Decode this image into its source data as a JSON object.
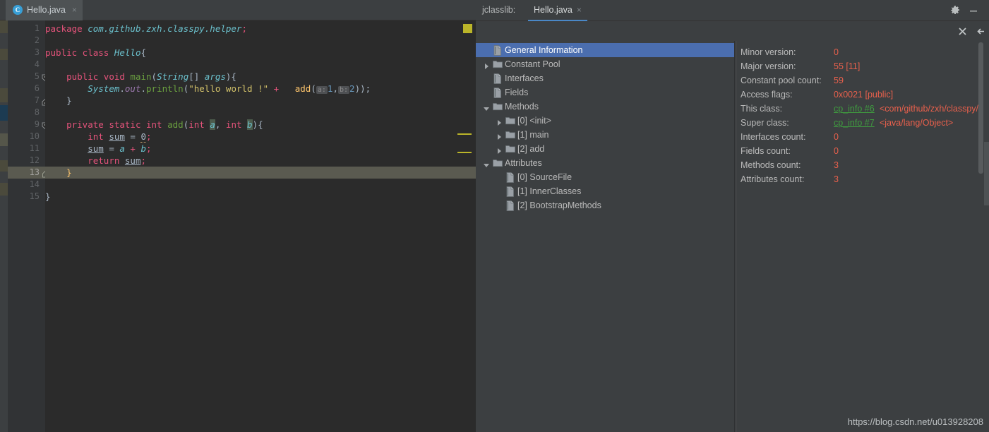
{
  "editor": {
    "tab": {
      "label": "Hello.java",
      "icon": "java-class-icon",
      "badge": "C",
      "close": "×"
    },
    "line_numbers": [
      "1",
      "2",
      "3",
      "4",
      "5",
      "6",
      "7",
      "8",
      "9",
      "10",
      "11",
      "12",
      "13",
      "14",
      "15"
    ],
    "current_line": 13,
    "code_lines": [
      {
        "n": 1,
        "tokens": [
          {
            "t": "package ",
            "c": "pink"
          },
          {
            "t": "com.github.zxh.classpy.helper",
            "c": "cy"
          },
          {
            "t": ";",
            "c": "pink"
          }
        ]
      },
      {
        "n": 2,
        "tokens": []
      },
      {
        "n": 3,
        "tokens": [
          {
            "t": "public class ",
            "c": "pink"
          },
          {
            "t": "Hello",
            "c": "cy"
          },
          {
            "t": "{",
            "c": "brc"
          }
        ]
      },
      {
        "n": 4,
        "tokens": []
      },
      {
        "n": 5,
        "tokens": [
          {
            "t": "    ",
            "c": "pl"
          },
          {
            "t": "public void ",
            "c": "pink"
          },
          {
            "t": "main",
            "c": "grn"
          },
          {
            "t": "(",
            "c": "brc"
          },
          {
            "t": "String",
            "c": "cy"
          },
          {
            "t": "[] ",
            "c": "brc"
          },
          {
            "t": "args",
            "c": "cy"
          },
          {
            "t": "){",
            "c": "brc"
          }
        ]
      },
      {
        "n": 6,
        "tokens": [
          {
            "t": "        ",
            "c": "pl"
          },
          {
            "t": "System",
            "c": "cy"
          },
          {
            "t": ".",
            "c": "brc"
          },
          {
            "t": "out",
            "c": "pur"
          },
          {
            "t": ".",
            "c": "brc"
          },
          {
            "t": "println",
            "c": "grn"
          },
          {
            "t": "(",
            "c": "brc"
          },
          {
            "t": "\"hello world !\"",
            "c": "str"
          },
          {
            "t": " + ",
            "c": "pink"
          },
          {
            "t": "  add",
            "c": "mth"
          },
          {
            "t": "(",
            "c": "brc"
          },
          {
            "t": "a:",
            "c": "hint"
          },
          {
            "t": "1",
            "c": "num"
          },
          {
            "t": ",",
            "c": "brc"
          },
          {
            "t": "b:",
            "c": "hint"
          },
          {
            "t": "2",
            "c": "num"
          },
          {
            "t": "));",
            "c": "brc"
          }
        ]
      },
      {
        "n": 7,
        "tokens": [
          {
            "t": "    }",
            "c": "brc"
          }
        ]
      },
      {
        "n": 8,
        "tokens": []
      },
      {
        "n": 9,
        "tokens": [
          {
            "t": "    ",
            "c": "pl"
          },
          {
            "t": "private static int ",
            "c": "pink"
          },
          {
            "t": "add",
            "c": "grn"
          },
          {
            "t": "(",
            "c": "brc"
          },
          {
            "t": "int ",
            "c": "pink"
          },
          {
            "t": "a",
            "c": "pbg-cy"
          },
          {
            "t": ", ",
            "c": "brc"
          },
          {
            "t": "int ",
            "c": "pink"
          },
          {
            "t": "b",
            "c": "pbg-cy"
          },
          {
            "t": "){",
            "c": "brc"
          }
        ]
      },
      {
        "n": 10,
        "tokens": [
          {
            "t": "        ",
            "c": "pl"
          },
          {
            "t": "int ",
            "c": "pink"
          },
          {
            "t": "sum",
            "c": "und"
          },
          {
            "t": " = ",
            "c": "brc"
          },
          {
            "t": "0",
            "c": "warnnum"
          },
          {
            "t": ";",
            "c": "pink"
          }
        ]
      },
      {
        "n": 11,
        "tokens": [
          {
            "t": "        ",
            "c": "pl"
          },
          {
            "t": "sum",
            "c": "und"
          },
          {
            "t": " = ",
            "c": "brc"
          },
          {
            "t": "a",
            "c": "cy"
          },
          {
            "t": " + ",
            "c": "pink"
          },
          {
            "t": "b",
            "c": "cy"
          },
          {
            "t": ";",
            "c": "pink"
          }
        ]
      },
      {
        "n": 12,
        "tokens": [
          {
            "t": "        ",
            "c": "pl"
          },
          {
            "t": "return ",
            "c": "pink"
          },
          {
            "t": "sum",
            "c": "und"
          },
          {
            "t": ";",
            "c": "pink"
          }
        ]
      },
      {
        "n": 13,
        "tokens": [
          {
            "t": "    }",
            "c": "mth"
          }
        ]
      },
      {
        "n": 14,
        "tokens": []
      },
      {
        "n": 15,
        "tokens": [
          {
            "t": "}",
            "c": "brc"
          }
        ]
      }
    ]
  },
  "tool_window": {
    "title": "jclasslib:",
    "tab": {
      "label": "Hello.java",
      "close": "×"
    },
    "window_controls": [
      {
        "name": "settings-gear-button",
        "icon": "gear-icon"
      },
      {
        "name": "minimize-button",
        "icon": "minimize-icon"
      }
    ],
    "toolbar": [
      {
        "name": "close-button",
        "icon": "close-icon",
        "enabled": true
      },
      {
        "name": "back-button",
        "icon": "arrow-left-icon",
        "enabled": true
      },
      {
        "name": "forward-button",
        "icon": "arrow-right-icon",
        "enabled": false
      },
      {
        "name": "reload-button",
        "icon": "refresh-icon",
        "enabled": true
      },
      {
        "name": "browse-button",
        "icon": "globe-icon",
        "enabled": true
      }
    ],
    "tree": [
      {
        "label": "General Information",
        "icon": "page-icon",
        "indent": 0,
        "arrow": "none",
        "selected": true
      },
      {
        "label": "Constant Pool",
        "icon": "folder-icon",
        "indent": 0,
        "arrow": "collapsed",
        "selected": false
      },
      {
        "label": "Interfaces",
        "icon": "page-icon",
        "indent": 0,
        "arrow": "none",
        "selected": false
      },
      {
        "label": "Fields",
        "icon": "page-icon",
        "indent": 0,
        "arrow": "none",
        "selected": false
      },
      {
        "label": "Methods",
        "icon": "folder-icon",
        "indent": 0,
        "arrow": "expanded",
        "selected": false
      },
      {
        "label": "[0] <init>",
        "icon": "folder-icon",
        "indent": 1,
        "arrow": "collapsed",
        "selected": false
      },
      {
        "label": "[1] main",
        "icon": "folder-icon",
        "indent": 1,
        "arrow": "collapsed",
        "selected": false
      },
      {
        "label": "[2] add",
        "icon": "folder-icon",
        "indent": 1,
        "arrow": "collapsed",
        "selected": false
      },
      {
        "label": "Attributes",
        "icon": "folder-icon",
        "indent": 0,
        "arrow": "expanded",
        "selected": false
      },
      {
        "label": "[0] SourceFile",
        "icon": "page-icon",
        "indent": 1,
        "arrow": "none",
        "selected": false
      },
      {
        "label": "[1] InnerClasses",
        "icon": "page-icon",
        "indent": 1,
        "arrow": "none",
        "selected": false
      },
      {
        "label": "[2] BootstrapMethods",
        "icon": "page-icon",
        "indent": 1,
        "arrow": "none",
        "selected": false
      }
    ],
    "details": [
      {
        "label": "Minor version:",
        "value": "0"
      },
      {
        "label": "Major version:",
        "value": "55 [11]"
      },
      {
        "label": "Constant pool count:",
        "value": "59"
      },
      {
        "label": "Access flags:",
        "value": "0x0021 [public]"
      },
      {
        "label": "This class:",
        "link": "cp_info #6",
        "extra": "<com/github/zxh/classpy/"
      },
      {
        "label": "Super class:",
        "link": "cp_info #7",
        "extra": "<java/lang/Object>"
      },
      {
        "label": "Interfaces count:",
        "value": "0"
      },
      {
        "label": "Fields count:",
        "value": "0"
      },
      {
        "label": "Methods count:",
        "value": "3"
      },
      {
        "label": "Attributes count:",
        "value": "3"
      }
    ]
  },
  "watermark": "https://blog.csdn.net/u013928208",
  "colors": {
    "editor_bg": "#2b2b2b",
    "panel_bg": "#3c3f41",
    "gutter_bg": "#313335",
    "selection_blue": "#4b6eaf",
    "value_red": "#e8604c",
    "link_green": "#3f9c3f",
    "marker_yellow": "#bbb529",
    "current_line": "#5a5a50"
  }
}
